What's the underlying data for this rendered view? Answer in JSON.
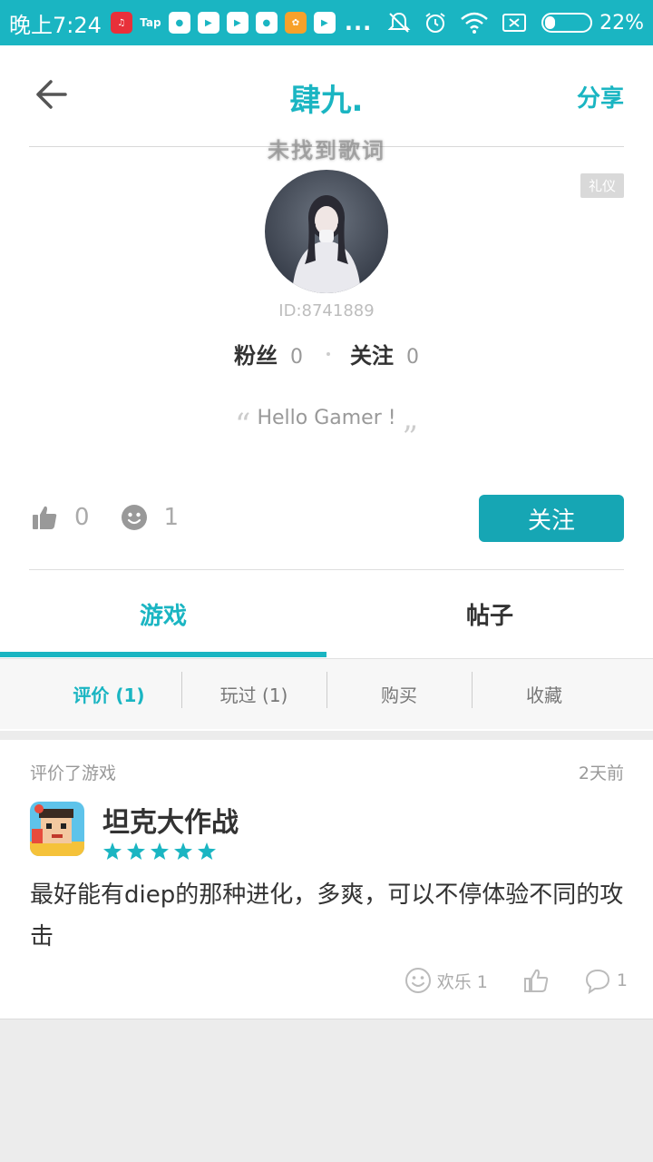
{
  "status_bar": {
    "time": "晚上7:24",
    "tap_label": "Tap",
    "overflow": "...",
    "battery": "22%",
    "battery_level": 0.22
  },
  "header": {
    "title": "肆九.",
    "share": "分享"
  },
  "profile": {
    "lyric_overlay": "未找到歌词",
    "badge": "礼仪",
    "user_id": "ID:8741889",
    "fans_label": "粉丝",
    "fans_count": "0",
    "following_label": "关注",
    "following_count": "0",
    "bio": "Hello Gamer !",
    "likes": "0",
    "smiles": "1",
    "follow_button": "关注"
  },
  "tabs": [
    {
      "label": "游戏",
      "active": true
    },
    {
      "label": "帖子",
      "active": false
    }
  ],
  "subtabs": [
    {
      "label": "评价 (1)",
      "active": true
    },
    {
      "label": "玩过 (1)",
      "active": false
    },
    {
      "label": "购买",
      "active": false
    },
    {
      "label": "收藏",
      "active": false
    }
  ],
  "review": {
    "type_label": "评价了游戏",
    "time": "2天前",
    "game_name": "坦克大作战",
    "rating": 5,
    "text": "最好能有diep的那种进化，多爽，可以不停体验不同的攻击",
    "fun_label": "欢乐 1",
    "comments": "1"
  },
  "colors": {
    "accent": "#1ab5c2",
    "button": "#16a6b4"
  }
}
